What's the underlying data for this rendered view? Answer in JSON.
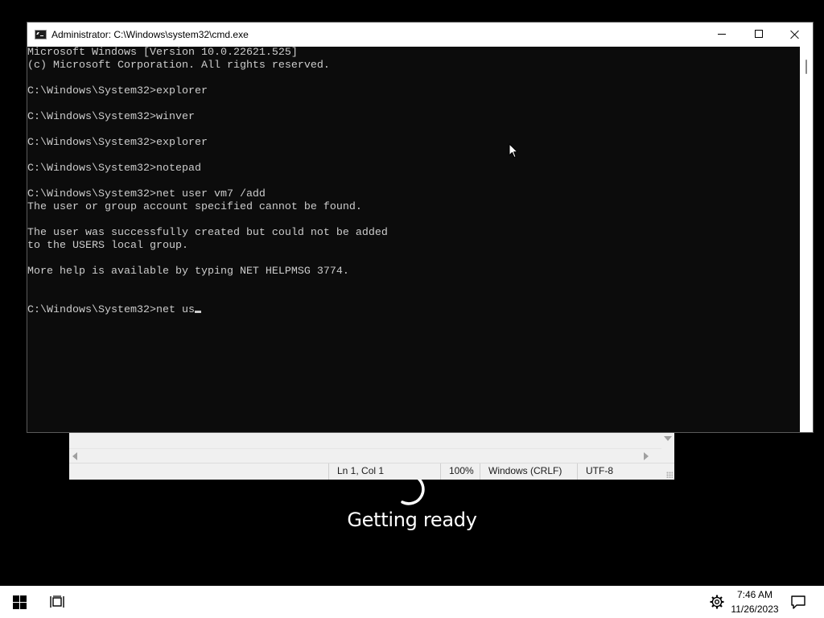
{
  "cmd_window": {
    "title": "Administrator: C:\\Windows\\system32\\cmd.exe",
    "icon": "cmd-icon",
    "controls": {
      "minimize": "minimize-icon",
      "maximize": "maximize-icon",
      "close": "close-icon"
    },
    "console_lines": [
      "Microsoft Windows [Version 10.0.22621.525]",
      "(c) Microsoft Corporation. All rights reserved.",
      "",
      "C:\\Windows\\System32>explorer",
      "",
      "C:\\Windows\\System32>winver",
      "",
      "C:\\Windows\\System32>explorer",
      "",
      "C:\\Windows\\System32>notepad",
      "",
      "C:\\Windows\\System32>net user vm7 /add",
      "The user or group account specified cannot be found.",
      "",
      "The user was successfully created but could not be added",
      "to the USERS local group.",
      "",
      "More help is available by typing NET HELPMSG 3774.",
      "",
      "",
      "C:\\Windows\\System32>net us"
    ],
    "colors": {
      "background": "#0c0c0c",
      "text": "#cccccc"
    }
  },
  "notepad": {
    "status": {
      "position": "Ln 1, Col 1",
      "zoom": "100%",
      "line_ending": "Windows (CRLF)",
      "encoding": "UTF-8"
    }
  },
  "overlay": {
    "message": "Getting ready"
  },
  "taskbar": {
    "start": "windows-logo-icon",
    "task_view": "task-view-icon",
    "settings": "gear-icon",
    "clock_time": "7:46 AM",
    "clock_date": "11/26/2023",
    "notifications": "notification-icon"
  }
}
